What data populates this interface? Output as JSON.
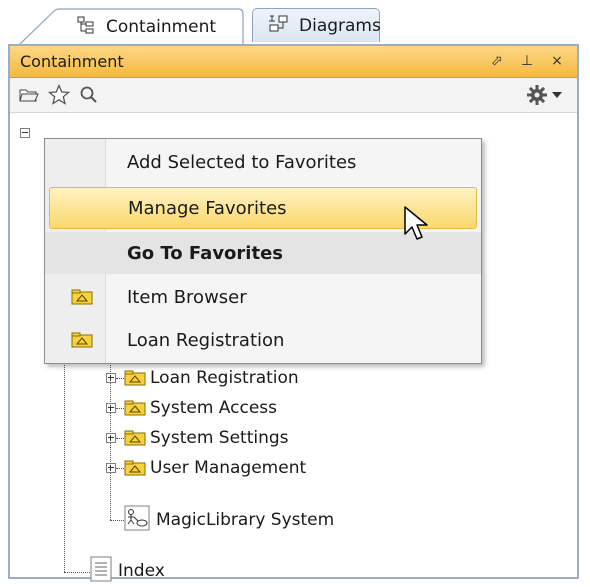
{
  "tabs": [
    {
      "label": "Containment",
      "icon": "containment-tree-icon",
      "active": true
    },
    {
      "label": "Diagrams",
      "icon": "diagrams-icon",
      "active": false
    }
  ],
  "panel": {
    "title": "Containment",
    "header_icons": [
      "popout-icon",
      "pin-icon",
      "close-icon"
    ],
    "header_symbols": [
      "⬀",
      "⊥",
      "×"
    ],
    "toolbar": [
      "open-folder-icon",
      "favorites-star-icon",
      "search-icon",
      "settings-gear-icon",
      "dropdown-arrow-icon"
    ]
  },
  "menu": {
    "items": [
      {
        "label": "Add Selected to Favorites"
      },
      {
        "label": "Manage Favorites"
      },
      {
        "label": "Go To Favorites"
      },
      {
        "label": "Item Browser"
      },
      {
        "label": "Loan Registration"
      }
    ]
  },
  "tree": {
    "items": [
      {
        "label": "Loan Registration"
      },
      {
        "label": "System Access"
      },
      {
        "label": "System Settings"
      },
      {
        "label": "User Management"
      },
      {
        "label": "MagicLibrary System"
      },
      {
        "label": "Index"
      }
    ]
  },
  "colors": {
    "header": "#f6b93e",
    "package_fill": "#f7d23c",
    "hover": "#fbd86c"
  }
}
